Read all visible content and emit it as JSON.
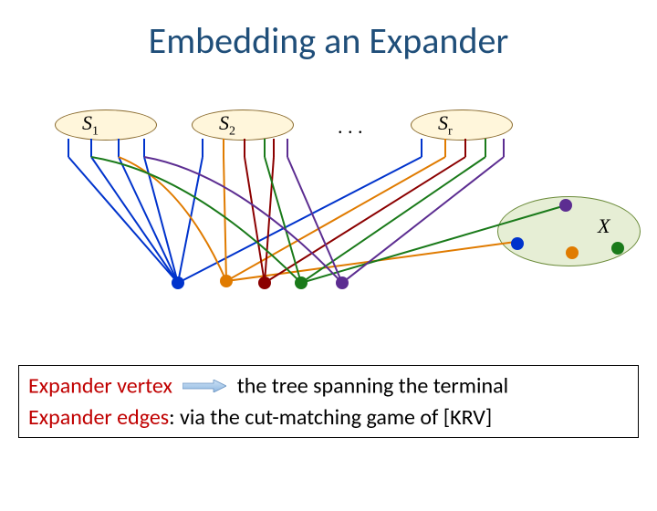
{
  "title": "Embedding an Expander",
  "sets": {
    "s1": "S",
    "s1_sub": "1",
    "s2": "S",
    "s2_sub": "2",
    "sr": "S",
    "sr_sub": "r",
    "ellipsis": ". . .",
    "x_label": "X"
  },
  "caption": {
    "line1_prefix": "Expander vertex",
    "line1_suffix": "the tree spanning the terminal",
    "line2_prefix": "Expander edges",
    "line2_suffix": ": via the cut-matching game of [KRV]"
  },
  "colors": {
    "blue": "#0033cc",
    "orange": "#e07b00",
    "darkred": "#8b0000",
    "green": "#1a7a1a",
    "purple": "#5c2d91",
    "tree_accent": "#c00000"
  }
}
